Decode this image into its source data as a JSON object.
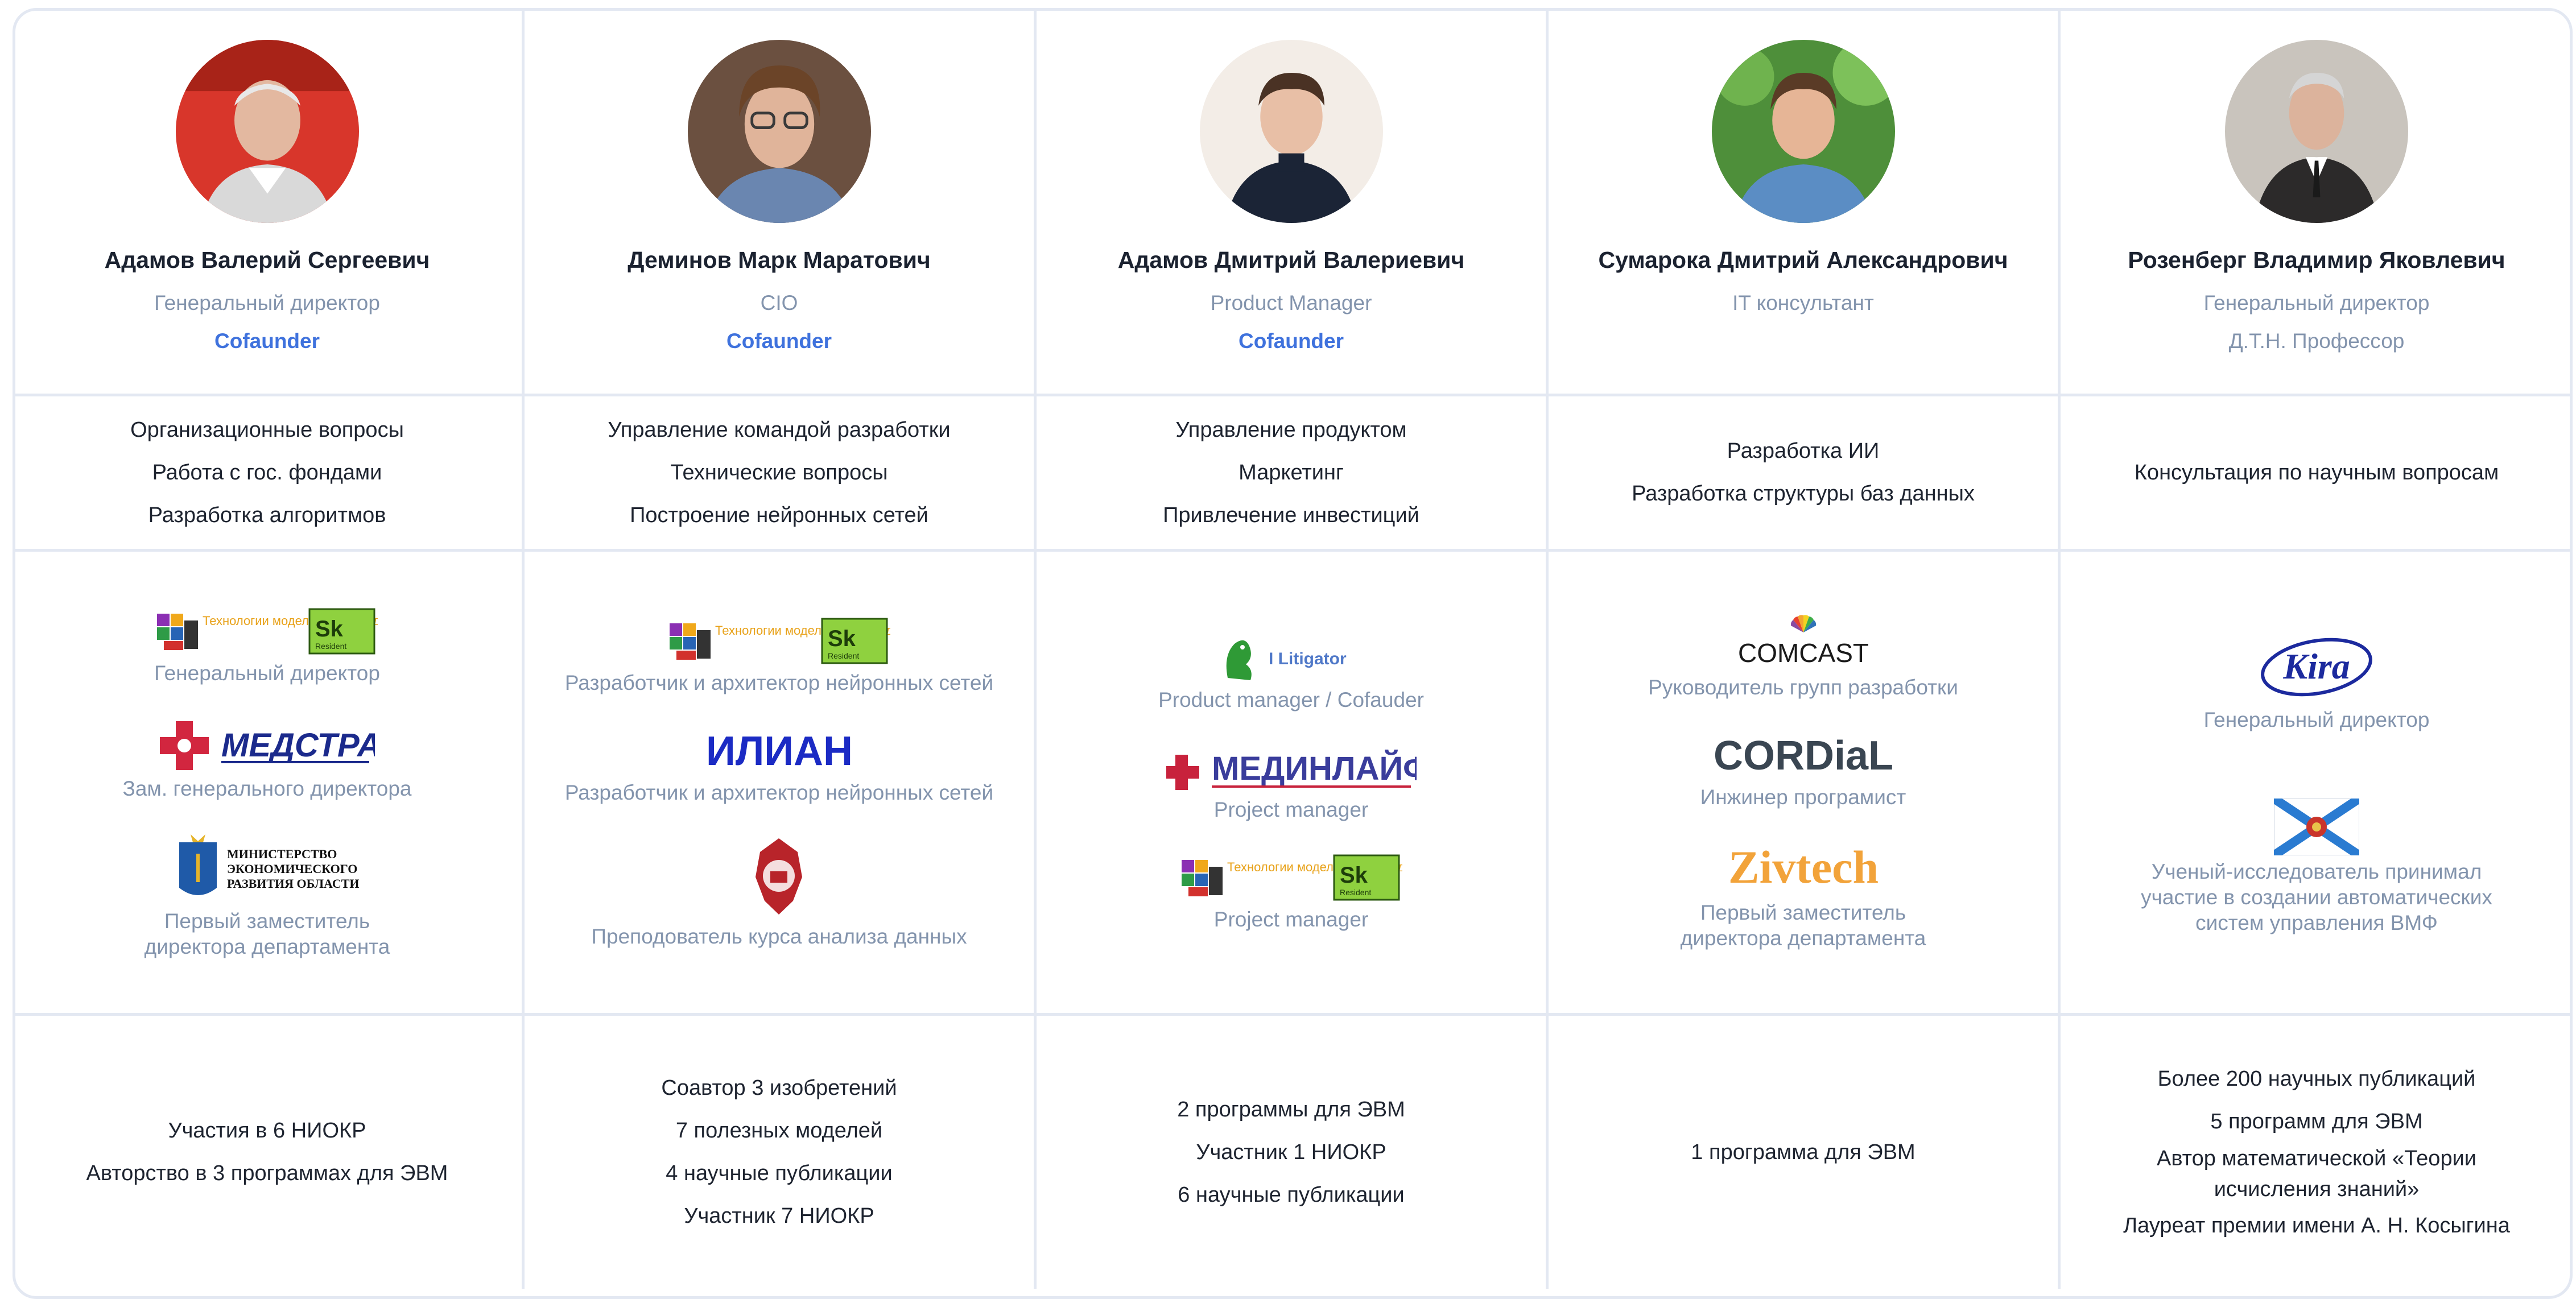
{
  "team": [
    {
      "name": "Адамов Валерий Сергеевич",
      "role": "Генеральный директор",
      "tag": "Cofaunder",
      "tag_style": "accent",
      "skills": [
        "Организационные вопросы",
        "Работа с гос. фондами",
        "Разработка алгоритмов"
      ],
      "experience": [
        {
          "logo": "tmz-sk-logo",
          "logo_text": "Технологии моделирования здоровья",
          "logo_badge": "Sk",
          "logo_badge_sub": "Resident",
          "label": "Генеральный директор"
        },
        {
          "logo": "medstrakh-logo",
          "logo_text": "МЕДСТРАХ",
          "label": "Зам. генерального директора"
        },
        {
          "logo": "ministry-logo",
          "logo_text": "МИНИСТЕРСТВО ЭКОНОМИЧЕСКОГО РАЗВИТИЯ ОБЛАСТИ",
          "label": "Первый заместитель директора департамента"
        }
      ],
      "achievements": [
        "Участия в 6 НИОКР",
        "Авторство в 3 программах для ЭВМ"
      ]
    },
    {
      "name": "Деминов Марк Маратович",
      "role": "CIO",
      "tag": "Cofaunder",
      "tag_style": "accent",
      "skills": [
        "Управление командой разработки",
        "Технические вопросы",
        "Построение нейронных сетей"
      ],
      "experience": [
        {
          "logo": "tmz-sk-logo",
          "logo_text": "Технологии моделирования здоровья",
          "logo_badge": "Sk",
          "logo_badge_sub": "Resident",
          "label": "Разработчик и архитектор нейронных сетей"
        },
        {
          "logo": "ilian-logo",
          "logo_text": "ИЛИАН",
          "label": "Разработчик и архитектор нейронных сетей"
        },
        {
          "logo": "university-crest-logo",
          "logo_text": "",
          "label": "Преподователь курса анализа данных"
        }
      ],
      "achievements": [
        "Соавтор 3 изобретений",
        "7 полезных моделей",
        "4 научные публикации",
        "Участник 7 НИОКР"
      ]
    },
    {
      "name": "Адамов Дмитрий Валериевич",
      "role": "Product Manager",
      "tag": "Cofaunder",
      "tag_style": "accent",
      "skills": [
        "Управление продуктом",
        "Маркетинг",
        "Привлечение инвестиций"
      ],
      "experience": [
        {
          "logo": "litigator-logo",
          "logo_text": "I Litigator",
          "label": "Product manager / Cofauder"
        },
        {
          "logo": "medinlife-logo",
          "logo_text": "МЕДИНЛАЙФ",
          "label": "Project manager"
        },
        {
          "logo": "tmz-sk-logo",
          "logo_text": "Технологии моделирования здоровья",
          "logo_badge": "Sk",
          "logo_badge_sub": "Resident",
          "label": "Project manager"
        }
      ],
      "achievements": [
        "2 программы для ЭВМ",
        "Участник 1 НИОКР",
        "6 научные публикации"
      ]
    },
    {
      "name": "Сумарока Дмитрий Александрович",
      "role": "IT консультант",
      "tag": "",
      "tag_style": "none",
      "skills": [
        "Разработка ИИ",
        "Разработка структуры баз данных"
      ],
      "experience": [
        {
          "logo": "comcast-logo",
          "logo_text": "COMCAST",
          "label": "Руководитель групп разработки"
        },
        {
          "logo": "cordial-logo",
          "logo_text": "CORDiaL",
          "label": "Инжинер програмист"
        },
        {
          "logo": "zivtech-logo",
          "logo_text": "Zivtech",
          "label": "Первый заместитель директора департамента"
        }
      ],
      "achievements": [
        "1 программа для ЭВМ"
      ]
    },
    {
      "name": "Розенберг Владимир Яковлевич",
      "role": "Генеральный директор",
      "tag": "Д.Т.Н. Профессор",
      "tag_style": "muted",
      "skills": [
        "Консультация по научным вопросам"
      ],
      "experience": [
        {
          "logo": "kira-logo",
          "logo_text": "Kira",
          "label": "Генеральный директор"
        },
        {
          "logo": "navy-flag-logo",
          "logo_text": "",
          "label": "Ученый-исследователь принимал участие в создании автоматических систем управления ВМФ"
        }
      ],
      "achievements": [
        "Более 200 научных публикаций",
        "5 программ для ЭВМ",
        "Автор математической «Теории исчисления знаний»",
        "Лауреат премии имени А. Н. Косыгина"
      ]
    }
  ],
  "colors": {
    "accent": "#3f72dd",
    "muted": "#8394ad",
    "border": "#e3e8f2",
    "text": "#1e2430"
  }
}
